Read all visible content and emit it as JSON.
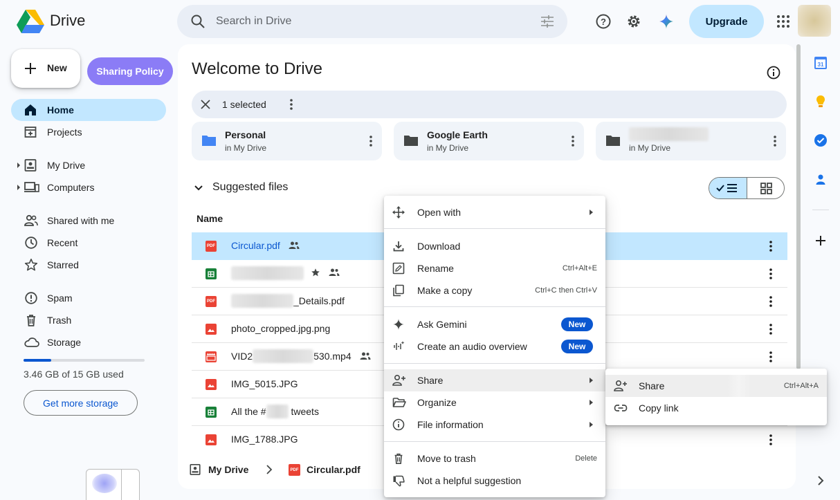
{
  "app": {
    "title": "Drive"
  },
  "search": {
    "placeholder": "Search in Drive"
  },
  "header": {
    "upgrade_label": "Upgrade"
  },
  "sidebar": {
    "new_label": "New",
    "sharing_policy_label": "Sharing Policy",
    "items": [
      {
        "label": "Home",
        "icon": "home-icon"
      },
      {
        "label": "Projects",
        "icon": "projects-icon"
      },
      {
        "label": "My Drive",
        "icon": "my-drive-icon"
      },
      {
        "label": "Computers",
        "icon": "computers-icon"
      },
      {
        "label": "Shared with me",
        "icon": "shared-icon"
      },
      {
        "label": "Recent",
        "icon": "recent-icon"
      },
      {
        "label": "Starred",
        "icon": "star-icon"
      },
      {
        "label": "Spam",
        "icon": "spam-icon"
      },
      {
        "label": "Trash",
        "icon": "trash-icon"
      },
      {
        "label": "Storage",
        "icon": "cloud-icon"
      }
    ],
    "storage_used_fraction": 0.23,
    "storage_text": "3.46 GB of 15 GB used",
    "get_storage_label": "Get more storage"
  },
  "main": {
    "title": "Welcome to Drive",
    "selection": {
      "text": "1 selected"
    },
    "folders": [
      {
        "name": "Personal",
        "location": "in My Drive",
        "color": "#4285f4"
      },
      {
        "name": "Google Earth",
        "location": "in My Drive",
        "color": "#444746"
      },
      {
        "name": "",
        "location": "in My Drive",
        "color": "#444746"
      }
    ],
    "suggested_label": "Suggested files",
    "column_name": "Name",
    "files": [
      {
        "name": "Circular.pdf",
        "type": "pdf",
        "selected": true,
        "shared": true
      },
      {
        "name": "",
        "type": "sheet",
        "starred": true,
        "shared": true
      },
      {
        "name": "_Details.pdf",
        "type": "pdf"
      },
      {
        "name": "photo_cropped.jpg.png",
        "type": "image"
      },
      {
        "name_prefix": "VID2",
        "name_suffix": "530.mp4",
        "type": "video",
        "shared": true
      },
      {
        "name": "IMG_5015.JPG",
        "type": "image"
      },
      {
        "name_prefix": "All the #",
        "name_suffix": " tweets",
        "type": "sheet"
      },
      {
        "name": "IMG_1788.JPG",
        "type": "image"
      }
    ],
    "breadcrumb": {
      "root": "My Drive",
      "file": "Circular.pdf"
    }
  },
  "context_menu": {
    "open_with": "Open with",
    "download": "Download",
    "rename": "Rename",
    "rename_shortcut": "Ctrl+Alt+E",
    "make_copy": "Make a copy",
    "make_copy_shortcut": "Ctrl+C then Ctrl+V",
    "ask_gemini": "Ask Gemini",
    "audio_overview": "Create an audio overview",
    "new_badge": "New",
    "share": "Share",
    "organize": "Organize",
    "file_information": "File information",
    "move_to_trash": "Move to trash",
    "move_to_trash_shortcut": "Delete",
    "not_helpful": "Not a helpful suggestion"
  },
  "share_submenu": {
    "share": "Share",
    "share_shortcut": "Ctrl+Alt+A",
    "copy_link": "Copy link"
  },
  "colors": {
    "accent": "#0b57d0",
    "selected_bg": "#c2e7ff",
    "sharing_policy": "#8b7cf6"
  }
}
